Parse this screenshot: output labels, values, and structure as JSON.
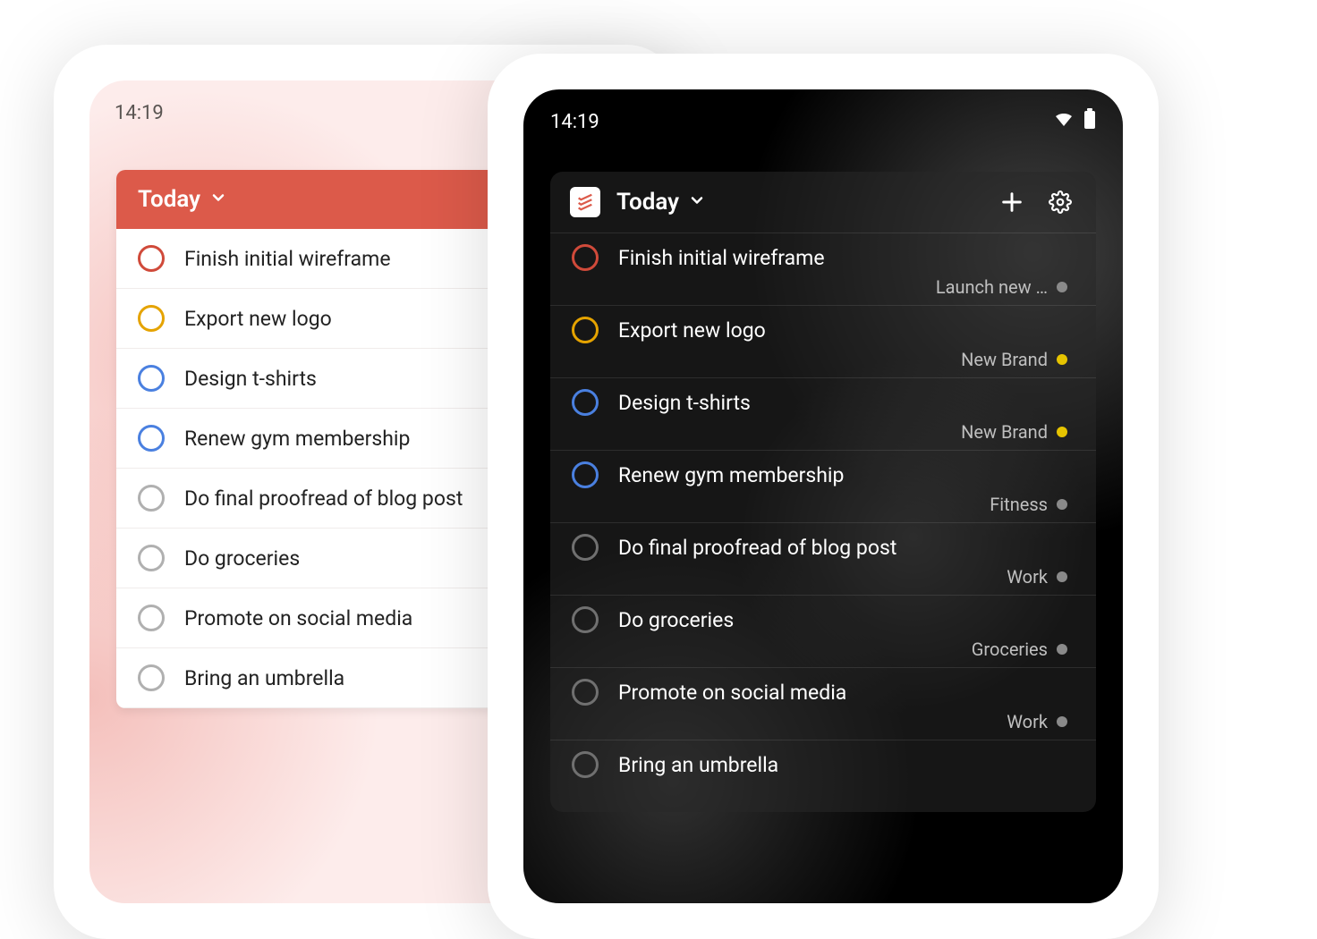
{
  "status": {
    "time_light": "14:19",
    "time_dark": "14:19"
  },
  "header": {
    "title_light": "Today",
    "title_dark": "Today"
  },
  "tasks_light": [
    {
      "title": "Finish initial wireframe",
      "color": "#d04a3a"
    },
    {
      "title": "Export new logo",
      "color": "#e5a300"
    },
    {
      "title": "Design t-shirts",
      "color": "#4a80e0"
    },
    {
      "title": "Renew gym membership",
      "color": "#4a80e0"
    },
    {
      "title": "Do final proofread of blog post",
      "color": "#b0b0b0"
    },
    {
      "title": "Do groceries",
      "color": "#b0b0b0"
    },
    {
      "title": "Promote on social media",
      "color": "#b0b0b0"
    },
    {
      "title": "Bring an umbrella",
      "color": "#b0b0b0"
    }
  ],
  "tasks_dark": [
    {
      "title": "Finish initial wireframe",
      "color": "#d04a3a",
      "project": "Launch new …",
      "dot": "#8a8a8a"
    },
    {
      "title": "Export new logo",
      "color": "#e5a300",
      "project": "New Brand",
      "dot": "#e6c400"
    },
    {
      "title": "Design t-shirts",
      "color": "#4a80e0",
      "project": "New Brand",
      "dot": "#e6c400"
    },
    {
      "title": "Renew gym membership",
      "color": "#4a80e0",
      "project": "Fitness",
      "dot": "#8a8a8a"
    },
    {
      "title": "Do final proofread of blog post",
      "color": "#707070",
      "project": "Work",
      "dot": "#8a8a8a"
    },
    {
      "title": "Do groceries",
      "color": "#707070",
      "project": "Groceries",
      "dot": "#8a8a8a"
    },
    {
      "title": "Promote on social media",
      "color": "#707070",
      "project": "Work",
      "dot": "#8a8a8a"
    },
    {
      "title": "Bring an umbrella",
      "color": "#707070",
      "project": "",
      "dot": ""
    }
  ]
}
